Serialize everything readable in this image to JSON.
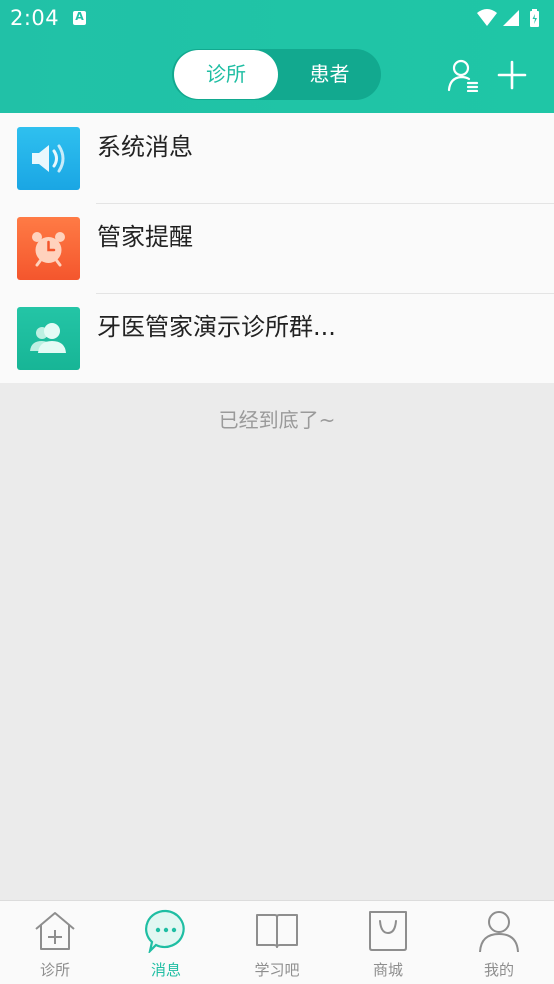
{
  "status_bar": {
    "time": "2:04",
    "notification_badge": "A"
  },
  "header": {
    "tabs": [
      {
        "label": "诊所",
        "active": true
      },
      {
        "label": "患者",
        "active": false
      }
    ],
    "icons": [
      "contacts-icon",
      "plus-icon"
    ]
  },
  "messages": [
    {
      "title": "系统消息",
      "icon": "speaker-icon",
      "icon_color": "#1fb0e9"
    },
    {
      "title": "管家提醒",
      "icon": "alarm-clock-icon",
      "icon_color": "#f7643a"
    },
    {
      "title": "牙医管家演示诊所群...",
      "icon": "group-icon",
      "icon_color": "#1fbea3"
    }
  ],
  "end_text": "已经到底了~",
  "bottom_tabs": [
    {
      "label": "诊所",
      "icon": "clinic-house-icon",
      "active": false
    },
    {
      "label": "消息",
      "icon": "chat-bubble-icon",
      "active": true
    },
    {
      "label": "学习吧",
      "icon": "book-icon",
      "active": false
    },
    {
      "label": "商城",
      "icon": "shopping-bag-icon",
      "active": false
    },
    {
      "label": "我的",
      "icon": "profile-icon",
      "active": false
    }
  ],
  "colors": {
    "accent": "#1fbea3",
    "accent_dark": "#12a98f",
    "background": "#ebebeb",
    "tab_inactive": "#8e8e8e"
  }
}
